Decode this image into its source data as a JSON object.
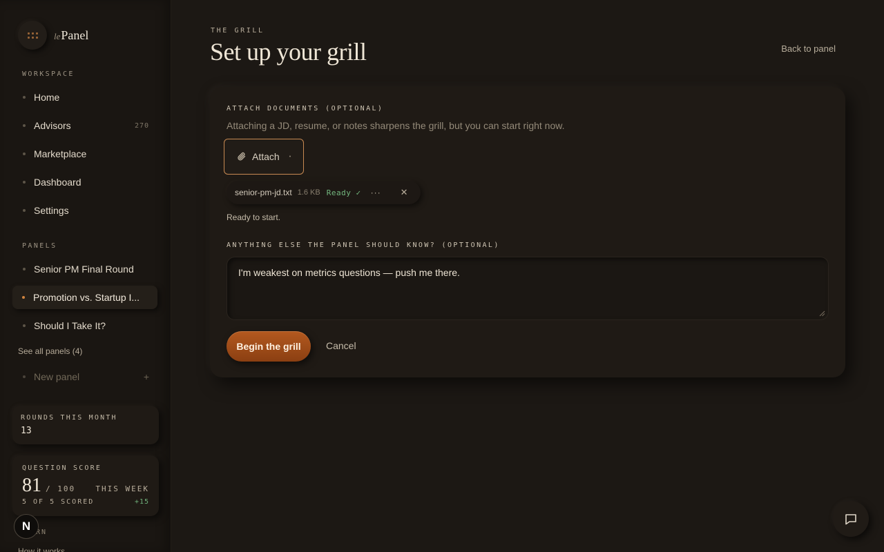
{
  "brand": {
    "prefix": "le",
    "name": "Panel"
  },
  "sidebar": {
    "workspace_label": "WORKSPACE",
    "workspace_items": [
      {
        "label": "Home"
      },
      {
        "label": "Advisors",
        "count": "270"
      },
      {
        "label": "Marketplace"
      },
      {
        "label": "Dashboard"
      },
      {
        "label": "Settings"
      }
    ],
    "panels_label": "PANELS",
    "panel_items": [
      {
        "label": "Senior PM Final Round"
      },
      {
        "label": "Promotion vs. Startup I..."
      },
      {
        "label": "Should I Take It?"
      }
    ],
    "see_all": "See all panels (4)",
    "new_panel": "New panel",
    "new_panel_plus": "+",
    "rounds_label": "ROUNDS THIS MONTH",
    "rounds_value": "13",
    "score_label": "QUESTION SCORE",
    "score_value": "81",
    "score_max": "/ 100",
    "score_period": "THIS WEEK",
    "scored_text": "5 OF 5 SCORED",
    "score_delta": "+15",
    "n_badge": "N",
    "learn_label": "RN",
    "how_link": "How it works"
  },
  "main": {
    "eyebrow": "THE GRILL",
    "title": "Set up your grill",
    "back_link": "Back to panel",
    "attach_label": "ATTACH DOCUMENTS (OPTIONAL)",
    "attach_helper": "Attaching a JD, resume, or notes sharpens the grill, but you can start right now.",
    "attach_button": "Attach",
    "file": {
      "name": "senior-pm-jd.txt",
      "size": "1.6 KB",
      "status": "Ready ✓",
      "more": "···",
      "close": "✕"
    },
    "ready_text": "Ready to start.",
    "notes_label": "ANYTHING ELSE THE PANEL SHOULD KNOW? (OPTIONAL)",
    "notes_value": "I'm weakest on metrics questions — push me there.",
    "begin_button": "Begin the grill",
    "cancel_button": "Cancel"
  },
  "colors": {
    "accent": "#b3591f",
    "accent_border": "#c88a52",
    "success": "#73b67e",
    "background": "#1c1814"
  },
  "icons": [
    "grid-icon",
    "paperclip-icon",
    "chat-icon",
    "close-icon",
    "more-icon"
  ]
}
